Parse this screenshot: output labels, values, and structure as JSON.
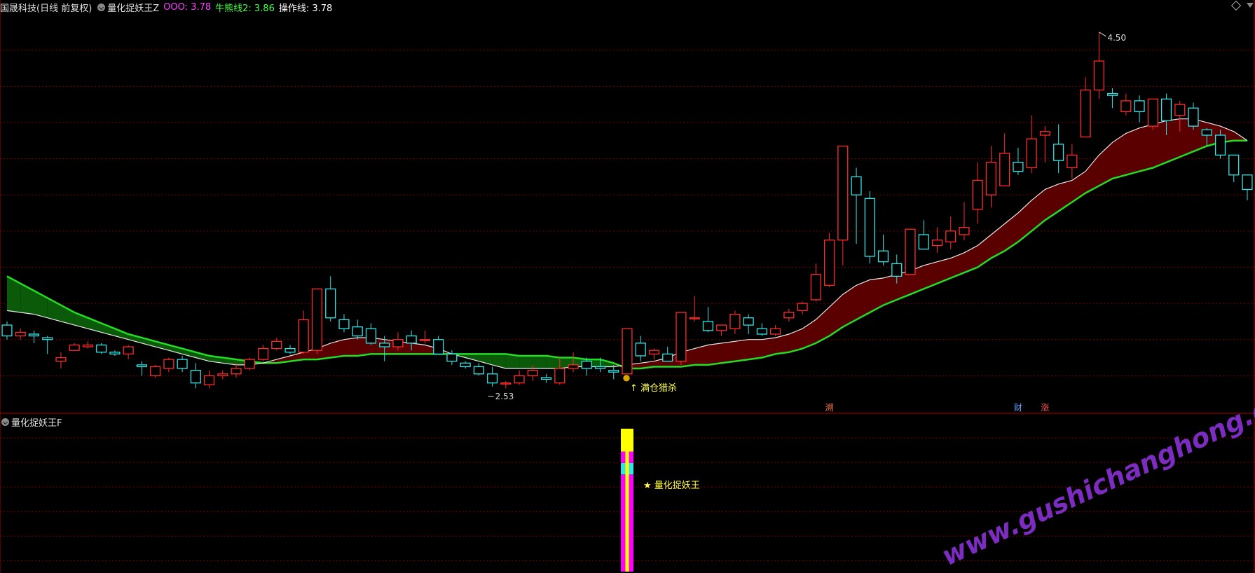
{
  "header": {
    "stock_name": "国晟科技(日线 前复权)",
    "indicator_name": "量化捉妖王Z",
    "ooo_label": "OOO: 3.78",
    "bull_bear_label": "牛熊线2: 3.86",
    "op_line_label": "操作线: 3.78"
  },
  "sub_panel": {
    "indicator_name": "量化捉妖王F"
  },
  "colors": {
    "up": "#ff2b2b",
    "down": "#2ee6e6",
    "white_line": "#e8e8e8",
    "green_line": "#22dd22",
    "band_bull": "#5a0000",
    "band_bear": "#0a5a0a",
    "magenta": "#ff00ff",
    "yellow": "#ffff00",
    "grid": "#7a0000",
    "label_yellow": "#ffff44",
    "ooo": "#ff44ff",
    "bullbear": "#44ff44"
  },
  "chart_data": {
    "type": "candlestick",
    "price_range": [
      2.4,
      4.6
    ],
    "max_label": "4.50",
    "min_label": "2.53",
    "signal_label": "满仓猎杀",
    "sub_label": "★ 量化捉妖王",
    "markers": {
      "m1": "溯",
      "m2": "财",
      "m3": "涨"
    },
    "watermark": "www.gushichanghong.com",
    "candles": [
      [
        2.88,
        2.82,
        2.9,
        2.8
      ],
      [
        2.82,
        2.84,
        2.86,
        2.8
      ],
      [
        2.83,
        2.82,
        2.85,
        2.78
      ],
      [
        2.81,
        2.8,
        2.82,
        2.72
      ],
      [
        2.68,
        2.7,
        2.73,
        2.64
      ],
      [
        2.74,
        2.77,
        2.78,
        2.74
      ],
      [
        2.76,
        2.77,
        2.79,
        2.75
      ],
      [
        2.77,
        2.73,
        2.78,
        2.72
      ],
      [
        2.73,
        2.72,
        2.74,
        2.71
      ],
      [
        2.72,
        2.76,
        2.77,
        2.69
      ],
      [
        2.66,
        2.65,
        2.68,
        2.6
      ],
      [
        2.6,
        2.65,
        2.66,
        2.59
      ],
      [
        2.64,
        2.69,
        2.7,
        2.62
      ],
      [
        2.69,
        2.64,
        2.71,
        2.62
      ],
      [
        2.63,
        2.56,
        2.67,
        2.53
      ],
      [
        2.55,
        2.6,
        2.63,
        2.53
      ],
      [
        2.6,
        2.61,
        2.63,
        2.58
      ],
      [
        2.61,
        2.64,
        2.67,
        2.59
      ],
      [
        2.64,
        2.69,
        2.7,
        2.63
      ],
      [
        2.69,
        2.75,
        2.77,
        2.68
      ],
      [
        2.75,
        2.79,
        2.81,
        2.74
      ],
      [
        2.75,
        2.73,
        2.77,
        2.72
      ],
      [
        2.73,
        2.91,
        2.96,
        2.72
      ],
      [
        2.74,
        3.08,
        3.08,
        2.72
      ],
      [
        3.08,
        2.92,
        3.15,
        2.9
      ],
      [
        2.91,
        2.86,
        2.94,
        2.84
      ],
      [
        2.87,
        2.82,
        2.91,
        2.8
      ],
      [
        2.86,
        2.78,
        2.89,
        2.77
      ],
      [
        2.78,
        2.76,
        2.82,
        2.68
      ],
      [
        2.76,
        2.8,
        2.84,
        2.74
      ],
      [
        2.82,
        2.78,
        2.85,
        2.74
      ],
      [
        2.8,
        2.8,
        2.85,
        2.78
      ],
      [
        2.8,
        2.72,
        2.82,
        2.72
      ],
      [
        2.72,
        2.68,
        2.74,
        2.66
      ],
      [
        2.67,
        2.65,
        2.68,
        2.64
      ],
      [
        2.65,
        2.61,
        2.67,
        2.6
      ],
      [
        2.61,
        2.56,
        2.65,
        2.54
      ],
      [
        2.56,
        2.56,
        2.57,
        2.53
      ],
      [
        2.56,
        2.6,
        2.63,
        2.55
      ],
      [
        2.6,
        2.63,
        2.66,
        2.57
      ],
      [
        2.59,
        2.58,
        2.61,
        2.56
      ],
      [
        2.56,
        2.64,
        2.7,
        2.55
      ],
      [
        2.64,
        2.66,
        2.73,
        2.62
      ],
      [
        2.68,
        2.64,
        2.7,
        2.6
      ],
      [
        2.65,
        2.64,
        2.7,
        2.62
      ],
      [
        2.63,
        2.62,
        2.66,
        2.58
      ],
      [
        2.61,
        2.86,
        2.86,
        2.61
      ],
      [
        2.78,
        2.71,
        2.82,
        2.68
      ],
      [
        2.72,
        2.74,
        2.75,
        2.69
      ],
      [
        2.72,
        2.68,
        2.76,
        2.68
      ],
      [
        2.68,
        2.95,
        2.95,
        2.66
      ],
      [
        2.92,
        2.92,
        3.04,
        2.9
      ],
      [
        2.9,
        2.85,
        2.98,
        2.84
      ],
      [
        2.85,
        2.88,
        2.88,
        2.82
      ],
      [
        2.86,
        2.94,
        2.96,
        2.83
      ],
      [
        2.92,
        2.88,
        2.94,
        2.83
      ],
      [
        2.86,
        2.83,
        2.89,
        2.82
      ],
      [
        2.83,
        2.86,
        2.88,
        2.82
      ],
      [
        2.92,
        2.95,
        2.97,
        2.9
      ],
      [
        2.96,
        3.0,
        3.01,
        2.94
      ],
      [
        3.02,
        3.16,
        3.22,
        3.01
      ],
      [
        3.1,
        3.35,
        3.39,
        3.09
      ],
      [
        3.35,
        3.87,
        3.87,
        3.21
      ],
      [
        3.7,
        3.6,
        3.75,
        3.33
      ],
      [
        3.58,
        3.26,
        3.62,
        3.22
      ],
      [
        3.29,
        3.23,
        3.38,
        3.21
      ],
      [
        3.22,
        3.15,
        3.27,
        3.11
      ],
      [
        3.16,
        3.41,
        3.41,
        3.16
      ],
      [
        3.38,
        3.3,
        3.46,
        3.3
      ],
      [
        3.32,
        3.35,
        3.42,
        3.28
      ],
      [
        3.34,
        3.4,
        3.48,
        3.3
      ],
      [
        3.38,
        3.42,
        3.56,
        3.35
      ],
      [
        3.52,
        3.68,
        3.78,
        3.44
      ],
      [
        3.6,
        3.78,
        3.87,
        3.53
      ],
      [
        3.65,
        3.83,
        3.94,
        3.65
      ],
      [
        3.78,
        3.73,
        3.86,
        3.71
      ],
      [
        3.75,
        3.91,
        4.04,
        3.72
      ],
      [
        3.93,
        3.95,
        3.98,
        3.78
      ],
      [
        3.88,
        3.79,
        3.99,
        3.72
      ],
      [
        3.75,
        3.82,
        3.88,
        3.69
      ],
      [
        3.92,
        4.18,
        4.25,
        3.92
      ],
      [
        4.18,
        4.34,
        4.5,
        4.13
      ],
      [
        4.16,
        4.15,
        4.19,
        4.08
      ],
      [
        4.06,
        4.12,
        4.16,
        4.04
      ],
      [
        4.12,
        4.06,
        4.15,
        4.0
      ],
      [
        3.98,
        4.13,
        4.13,
        3.96
      ],
      [
        4.13,
        4.01,
        4.16,
        3.93
      ],
      [
        4.04,
        4.1,
        4.12,
        3.95
      ],
      [
        4.08,
        3.98,
        4.11,
        3.96
      ],
      [
        3.96,
        3.93,
        3.97,
        3.87
      ],
      [
        3.93,
        3.82,
        3.96,
        3.8
      ],
      [
        3.82,
        3.71,
        3.82,
        3.67
      ],
      [
        3.71,
        3.63,
        3.71,
        3.57
      ]
    ],
    "white_line": [
      2.96,
      2.95,
      2.94,
      2.92,
      2.9,
      2.88,
      2.86,
      2.84,
      2.82,
      2.8,
      2.78,
      2.76,
      2.74,
      2.72,
      2.7,
      2.68,
      2.67,
      2.66,
      2.66,
      2.67,
      2.69,
      2.71,
      2.73,
      2.75,
      2.78,
      2.8,
      2.81,
      2.81,
      2.8,
      2.79,
      2.78,
      2.77,
      2.75,
      2.72,
      2.7,
      2.68,
      2.66,
      2.64,
      2.64,
      2.64,
      2.64,
      2.64,
      2.65,
      2.65,
      2.65,
      2.65,
      2.66,
      2.67,
      2.68,
      2.7,
      2.73,
      2.75,
      2.77,
      2.78,
      2.79,
      2.8,
      2.8,
      2.81,
      2.83,
      2.86,
      2.91,
      2.98,
      3.05,
      3.1,
      3.13,
      3.14,
      3.16,
      3.18,
      3.21,
      3.23,
      3.25,
      3.28,
      3.32,
      3.38,
      3.44,
      3.5,
      3.57,
      3.63,
      3.66,
      3.68,
      3.73,
      3.82,
      3.89,
      3.94,
      3.97,
      3.99,
      4.01,
      4.02,
      4.02,
      4.0,
      3.98,
      3.95,
      3.9
    ],
    "green_line": [
      3.15,
      3.11,
      3.07,
      3.03,
      2.99,
      2.95,
      2.92,
      2.89,
      2.86,
      2.83,
      2.81,
      2.79,
      2.77,
      2.75,
      2.73,
      2.71,
      2.7,
      2.69,
      2.68,
      2.67,
      2.67,
      2.68,
      2.69,
      2.69,
      2.7,
      2.71,
      2.71,
      2.72,
      2.72,
      2.72,
      2.72,
      2.72,
      2.72,
      2.72,
      2.72,
      2.72,
      2.72,
      2.72,
      2.71,
      2.71,
      2.71,
      2.7,
      2.7,
      2.69,
      2.69,
      2.67,
      2.64,
      2.64,
      2.65,
      2.65,
      2.65,
      2.66,
      2.66,
      2.67,
      2.68,
      2.69,
      2.7,
      2.72,
      2.73,
      2.75,
      2.78,
      2.82,
      2.87,
      2.91,
      2.95,
      2.99,
      3.02,
      3.05,
      3.08,
      3.11,
      3.14,
      3.17,
      3.2,
      3.25,
      3.29,
      3.34,
      3.4,
      3.46,
      3.51,
      3.56,
      3.61,
      3.65,
      3.69,
      3.71,
      3.73,
      3.75,
      3.78,
      3.81,
      3.84,
      3.87,
      3.89,
      3.9,
      3.9
    ],
    "signal_index": 46,
    "max_index": 81,
    "min_index": 36,
    "sub_bars": [
      {
        "color_key": "magenta",
        "from": 0.0,
        "to": 0.68
      },
      {
        "color_key": "down",
        "from": 0.68,
        "to": 0.76
      },
      {
        "color_key": "magenta",
        "from": 0.76,
        "to": 0.84
      },
      {
        "color_key": "yellow",
        "from": 0.84,
        "to": 1.0
      }
    ]
  }
}
